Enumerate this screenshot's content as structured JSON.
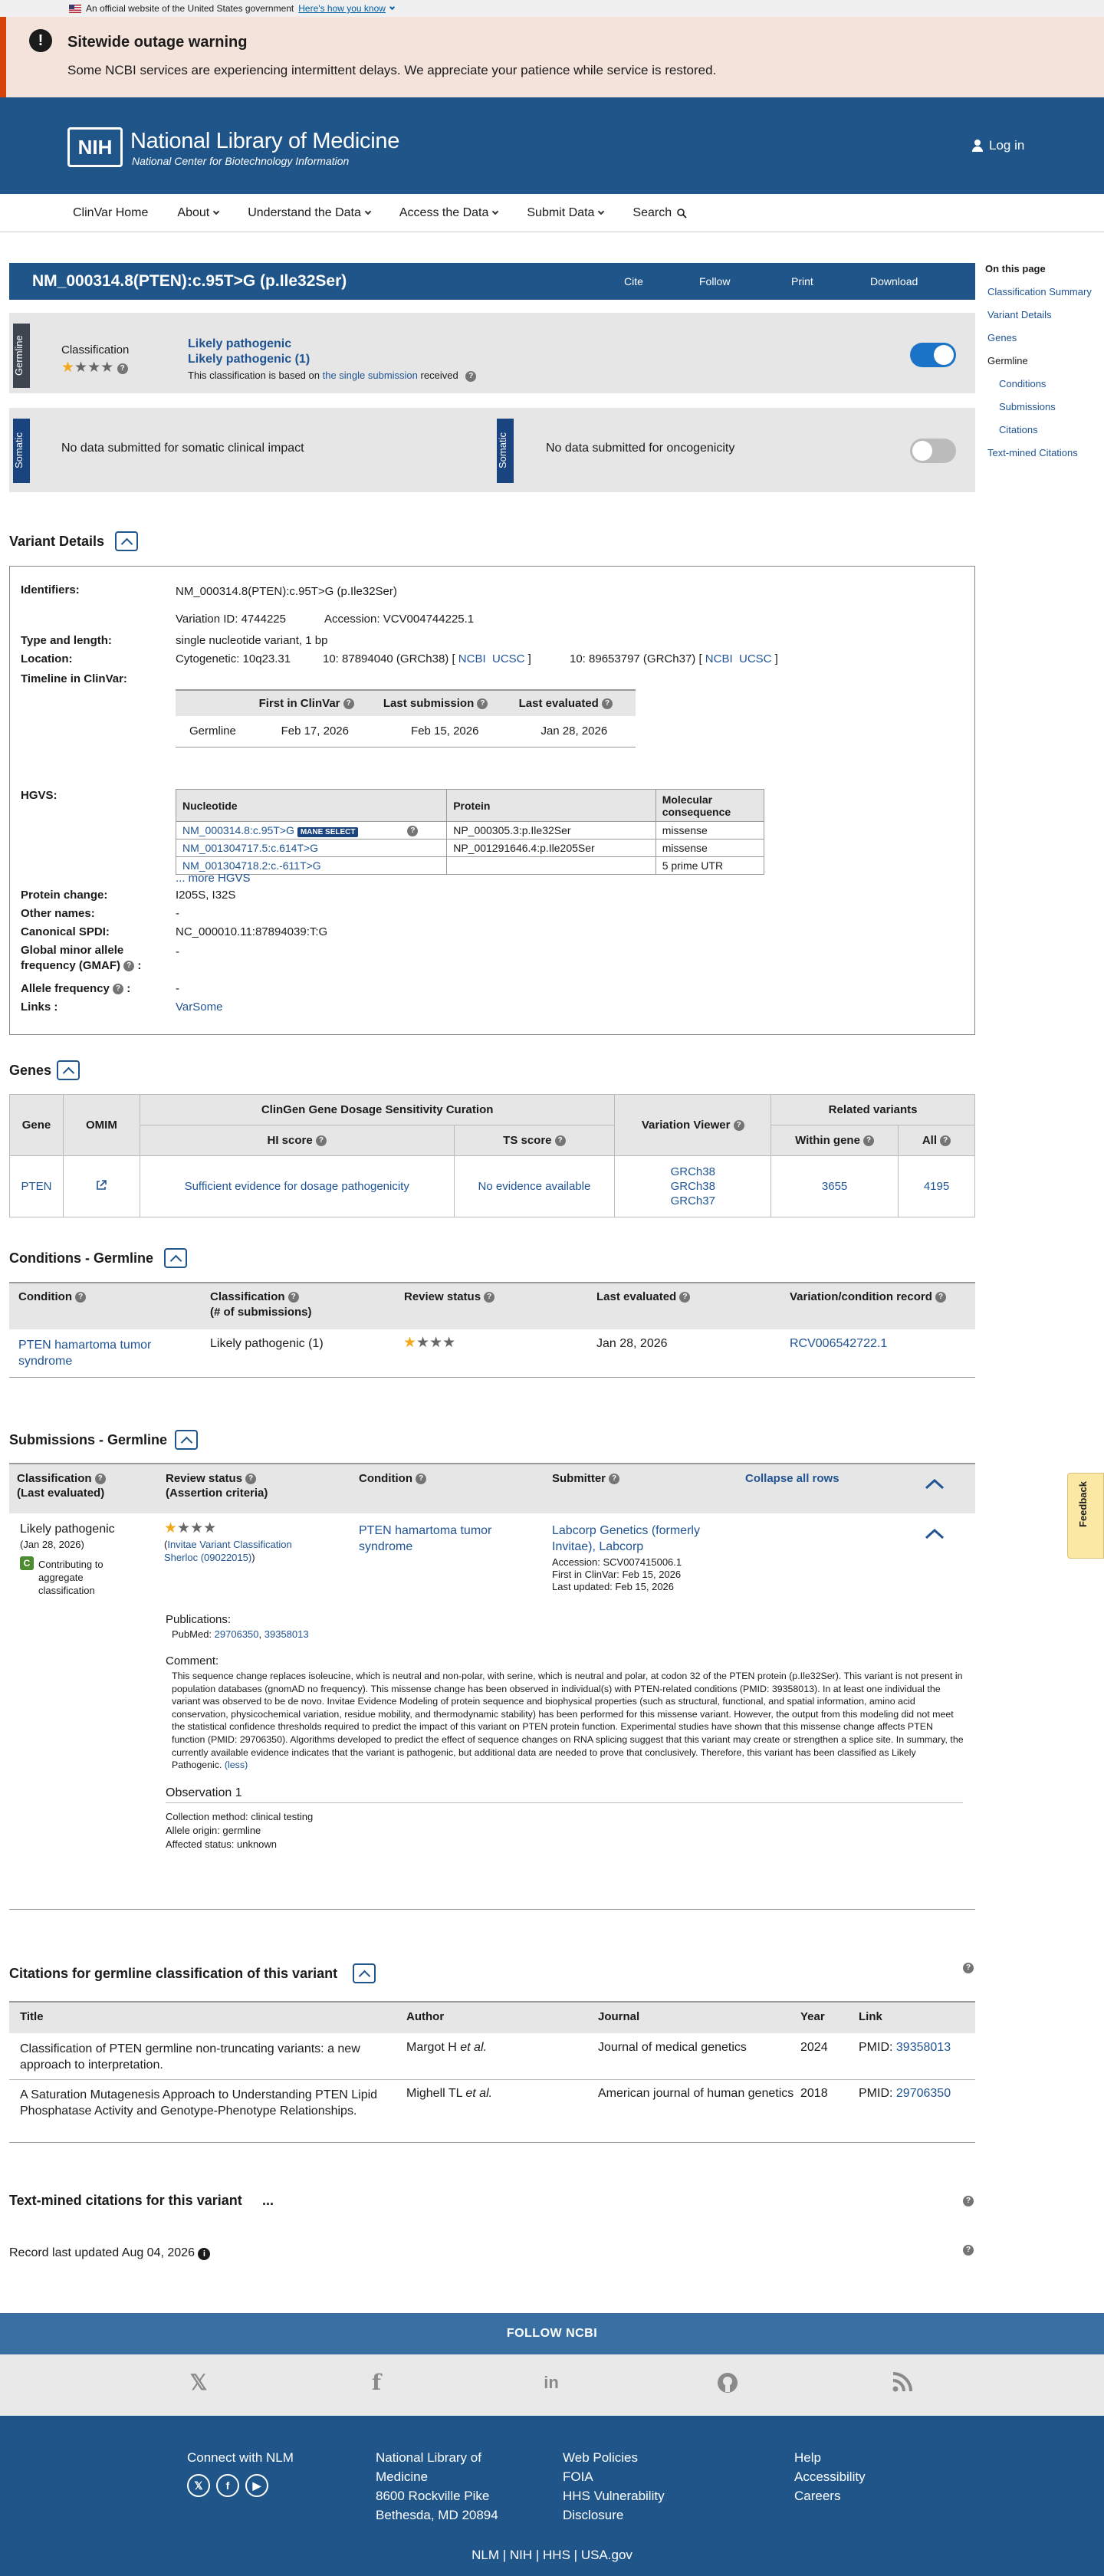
{
  "gov_banner": {
    "text": "An official website of the United States government",
    "how_link": "Here's how you know"
  },
  "outage": {
    "title": "Sitewide outage warning",
    "message": "Some NCBI services are experiencing intermittent delays. We appreciate your patience while service is restored."
  },
  "header": {
    "logo": "NIH",
    "title": "National Library of Medicine",
    "subtitle": "National Center for Biotechnology Information",
    "login": "Log in"
  },
  "nav": {
    "items": [
      "ClinVar Home",
      "About",
      "Understand the Data",
      "Access the Data",
      "Submit Data",
      "Search"
    ]
  },
  "title_bar": {
    "title": "NM_000314.8(PTEN):c.95T>G (p.Ile32Ser)",
    "actions": [
      "Cite",
      "Follow",
      "Print",
      "Download"
    ]
  },
  "on_this_page": {
    "heading": "On this page",
    "items": [
      "Classification Summary",
      "Variant Details",
      "Genes",
      "Germline",
      "Conditions",
      "Submissions",
      "Citations",
      "Text-mined Citations"
    ]
  },
  "germline": {
    "tab": "Germline",
    "label": "Classification",
    "line1": "Likely pathogenic",
    "line2": "Likely pathogenic (1)",
    "basis_pre": "This classification is based on",
    "basis_link": "the single submission",
    "basis_post": "received"
  },
  "somatic": {
    "tab": "Somatic",
    "clinical": "No data submitted for somatic clinical impact",
    "oncogenicity": "No data submitted for oncogenicity"
  },
  "variant_details": {
    "heading": "Variant Details",
    "identifiers_label": "Identifiers:",
    "identifier": "NM_000314.8(PTEN):c.95T>G (p.Ile32Ser)",
    "variation_id": "Variation ID: 4744225",
    "accession": "Accession: VCV004744225.1",
    "type_label": "Type and length:",
    "type_value": "single nucleotide variant, 1 bp",
    "location_label": "Location:",
    "cytogenetic": "Cytogenetic: 10q23.31",
    "grch38": "10: 87894040 (GRCh38) [",
    "grch37": "10: 89653797 (GRCh37) [",
    "ncbi": "NCBI",
    "ucsc": "UCSC",
    "bracket_close": "]",
    "timeline_label": "Timeline in ClinVar:",
    "timeline_headers": [
      "First in ClinVar",
      "Last submission",
      "Last evaluated"
    ],
    "timeline_row": [
      "Germline",
      "Feb 17, 2026",
      "Feb 15, 2026",
      "Jan 28, 2026"
    ],
    "hgvs_label": "HGVS:",
    "hgvs_headers": [
      "Nucleotide",
      "Protein",
      "Molecular consequence"
    ],
    "hgvs_rows": [
      [
        "NM_000314.8:c.95T>G",
        "NP_000305.3:p.Ile32Ser",
        "missense"
      ],
      [
        "NM_001304717.5:c.614T>G",
        "NP_001291646.4:p.Ile205Ser",
        "missense"
      ],
      [
        "NM_001304718.2:c.-611T>G",
        "",
        "5 prime UTR"
      ]
    ],
    "mane_badge": "MANE SELECT",
    "more_hgvs": "... more HGVS",
    "protein_change_label": "Protein change:",
    "protein_change": "I205S, I32S",
    "other_names_label": "Other names:",
    "other_names": "-",
    "spdi_label": "Canonical SPDI:",
    "spdi": "NC_000010.11:87894039:T:G",
    "gmaf_label_1": "Global minor allele",
    "gmaf_label_2": "frequency (GMAF)",
    "gmaf": "-",
    "af_label": "Allele frequency",
    "af": "-",
    "links_label": "Links :",
    "links": "VarSome"
  },
  "genes": {
    "heading": "Genes",
    "headers": {
      "gene": "Gene",
      "omim": "OMIM",
      "clingen": "ClinGen Gene Dosage Sensitivity Curation",
      "hi": "HI score",
      "ts": "TS score",
      "viewer": "Variation Viewer",
      "related": "Related variants",
      "within": "Within gene",
      "all": "All"
    },
    "row": {
      "gene": "PTEN",
      "hi": "Sufficient evidence for dosage pathogenicity",
      "ts": "No evidence available",
      "viewer": [
        "GRCh38",
        "GRCh38",
        "GRCh37"
      ],
      "within": "3655",
      "all": "4195"
    }
  },
  "conditions": {
    "heading": "Conditions - Germline",
    "headers": [
      "Condition",
      "Classification",
      "(# of submissions)",
      "Review status",
      "Last evaluated",
      "Variation/condition record"
    ],
    "row": {
      "condition": "PTEN hamartoma tumor syndrome",
      "classification": "Likely pathogenic (1)",
      "last_evaluated": "Jan 28, 2026",
      "record": "RCV006542722.1"
    }
  },
  "submissions": {
    "heading": "Submissions - Germline",
    "headers": [
      "Classification",
      "(Last evaluated)",
      "Review status",
      "(Assertion criteria)",
      "Condition",
      "Submitter"
    ],
    "collapse_all": "Collapse all rows",
    "row": {
      "classification": "Likely pathogenic",
      "date": "(Jan 28, 2026)",
      "contrib_badge": "C",
      "contrib": "Contributing to aggregate classification",
      "criteria": "Invitae Variant Classification Sherloc (09022015)",
      "condition": "PTEN hamartoma tumor syndrome",
      "submitter": "Labcorp Genetics (formerly Invitae), Labcorp",
      "scv": "Accession: SCV007415006.1",
      "first": "First in ClinVar: Feb 15, 2026",
      "updated": "Last updated: Feb 15, 2026",
      "publications_label": "Publications:",
      "pubmed_label": "PubMed:",
      "pubmed": [
        "29706350",
        "39358013"
      ],
      "comment_label": "Comment:",
      "comment": "This sequence change replaces isoleucine, which is neutral and non-polar, with serine, which is neutral and polar, at codon 32 of the PTEN protein (p.Ile32Ser). This variant is not present in population databases (gnomAD no frequency). This missense change has been observed in individual(s) with PTEN-related conditions (PMID: 39358013). In at least one individual the variant was observed to be de novo. Invitae Evidence Modeling of protein sequence and biophysical properties (such as structural, functional, and spatial information, amino acid conservation, physicochemical variation, residue mobility, and thermodynamic stability) has been performed for this missense variant. However, the output from this modeling did not meet the statistical confidence thresholds required to predict the impact of this variant on PTEN protein function. Experimental studies have shown that this missense change affects PTEN function (PMID: 29706350). Algorithms developed to predict the effect of sequence changes on RNA splicing suggest that this variant may create or strengthen a splice site. In summary, the currently available evidence indicates that the variant is pathogenic, but additional data are needed to prove that conclusively. Therefore, this variant has been classified as Likely Pathogenic.",
      "less": "(less)",
      "observation": "Observation 1",
      "method": "Collection method: clinical testing",
      "origin": "Allele origin: germline",
      "affected": "Affected status: unknown"
    }
  },
  "citations": {
    "heading": "Citations for germline classification of this variant",
    "headers": [
      "Title",
      "Author",
      "Journal",
      "Year",
      "Link"
    ],
    "rows": [
      {
        "title": "Classification of PTEN germline non-truncating variants: a new approach to interpretation.",
        "author": "Margot H",
        "etal": "et al.",
        "journal": "Journal of medical genetics",
        "year": "2024",
        "pmid_label": "PMID:",
        "pmid": "39358013"
      },
      {
        "title": "A Saturation Mutagenesis Approach to Understanding PTEN Lipid Phosphatase Activity and Genotype-Phenotype Relationships.",
        "author": "Mighell TL",
        "etal": "et al.",
        "journal": "American journal of human genetics",
        "year": "2018",
        "pmid_label": "PMID:",
        "pmid": "29706350"
      }
    ]
  },
  "text_mined": {
    "heading": "Text-mined citations for this variant",
    "dots": "..."
  },
  "record_updated": "Record last updated Aug 04, 2026",
  "feedback": "Feedback",
  "footer": {
    "follow": "FOLLOW NCBI",
    "connect": "Connect with NLM",
    "address": [
      "National Library of",
      "Medicine",
      "8600 Rockville Pike",
      "Bethesda, MD 20894"
    ],
    "links1": [
      "Web Policies",
      "FOIA",
      "HHS Vulnerability",
      "Disclosure"
    ],
    "links2": [
      "Help",
      "Accessibility",
      "Careers"
    ],
    "bottom": [
      "NLM",
      "NIH",
      "HHS",
      "USA.gov"
    ]
  },
  "colors": {
    "brand_blue": "#20558a",
    "star_gold": "#f2a81d",
    "toggle_on": "#1a73c7"
  }
}
